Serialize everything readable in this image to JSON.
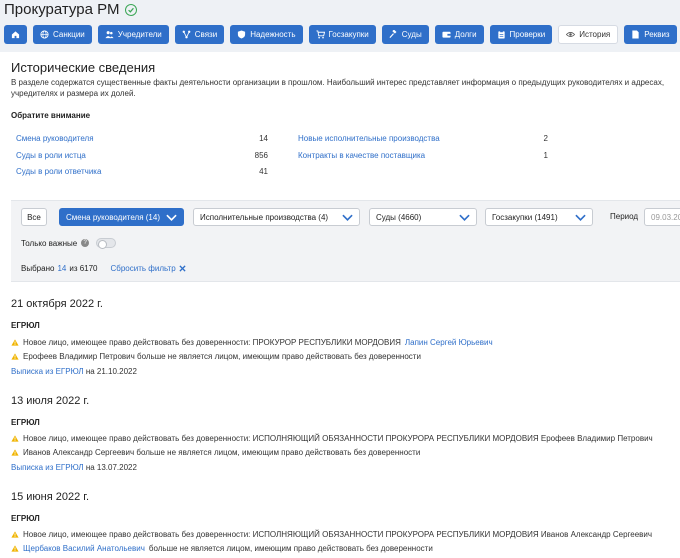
{
  "header": {
    "title": "Прокуратура РМ",
    "tabs": [
      {
        "label": "",
        "icon": "home-icon"
      },
      {
        "label": "Санкции",
        "icon": "globe-icon"
      },
      {
        "label": "Учредители",
        "icon": "users-icon"
      },
      {
        "label": "Связи",
        "icon": "network-icon"
      },
      {
        "label": "Надежность",
        "icon": "shield-icon"
      },
      {
        "label": "Госзакупки",
        "icon": "cart-icon"
      },
      {
        "label": "Суды",
        "icon": "gavel-icon"
      },
      {
        "label": "Долги",
        "icon": "wallet-icon"
      },
      {
        "label": "Проверки",
        "icon": "clipboard-icon"
      },
      {
        "label": "История",
        "icon": "eye-icon",
        "active": true
      },
      {
        "label": "Реквиз",
        "icon": "document-icon"
      }
    ]
  },
  "history": {
    "title": "Исторические сведения",
    "intro": "В разделе содержатся существенные факты деятельности организации в прошлом. Наибольший интерес представляет информация о предыдущих руководителях и адресах, учредителях и размера их долей.",
    "notice": "Обратите внимание",
    "stats_left": [
      {
        "label": "Смена руководителя",
        "value": "14"
      },
      {
        "label": "Суды в роли истца",
        "value": "856"
      },
      {
        "label": "Суды в роли ответчика",
        "value": "41"
      }
    ],
    "stats_right": [
      {
        "label": "Новые исполнительные производства",
        "value": "2"
      },
      {
        "label": "Контракты в качестве поставщика",
        "value": "1"
      }
    ]
  },
  "filters": {
    "all": "Все",
    "dropdowns": [
      {
        "label": "Смена руководителя (14)",
        "active": true
      },
      {
        "label": "Исполнительные производства (4)",
        "active": false
      },
      {
        "label": "Суды (4660)",
        "active": false
      },
      {
        "label": "Госзакупки (1491)",
        "active": false
      }
    ],
    "period_label": "Период",
    "period_value": "09.03.20",
    "important_label": "Только важные",
    "selected_prefix": "Выбрано",
    "selected_count": "14",
    "selected_of": "из 6170",
    "reset": "Сбросить фильтр"
  },
  "events": [
    {
      "date": "21 октября 2022 г.",
      "source": "ЕГРЮЛ",
      "items": [
        {
          "text": "Новое лицо, имеющее право действовать без доверенности: ПРОКУРОР РЕСПУБЛИКИ МОРДОВИЯ",
          "person": "Лапин Сергей Юрьевич",
          "person_first": false
        },
        {
          "text": "Ерофеев Владимир Петрович больше не является лицом, имеющим право действовать без доверенности",
          "person": "",
          "person_first": false
        }
      ],
      "extract_link": "Выписка из ЕГРЮЛ",
      "extract_date": "на 21.10.2022"
    },
    {
      "date": "13 июля 2022 г.",
      "source": "ЕГРЮЛ",
      "items": [
        {
          "text": "Новое лицо, имеющее право действовать без доверенности: ИСПОЛНЯЮЩИЙ ОБЯЗАННОСТИ ПРОКУРОРА РЕСПУБЛИКИ МОРДОВИЯ Ерофеев Владимир Петрович",
          "person": "",
          "person_first": false
        },
        {
          "text": "Иванов Александр Сергеевич больше не является лицом, имеющим право действовать без доверенности",
          "person": "",
          "person_first": false
        }
      ],
      "extract_link": "Выписка из ЕГРЮЛ",
      "extract_date": "на 13.07.2022"
    },
    {
      "date": "15 июня 2022 г.",
      "source": "ЕГРЮЛ",
      "items": [
        {
          "text": "Новое лицо, имеющее право действовать без доверенности: ИСПОЛНЯЮЩИЙ ОБЯЗАННОСТИ ПРОКУРОРА РЕСПУБЛИКИ МОРДОВИЯ Иванов Александр Сергеевич",
          "person": "",
          "person_first": false
        },
        {
          "text": "больше не является лицом, имеющим право действовать без доверенности",
          "person": "Щербаков Василий Анатольевич",
          "person_first": true
        }
      ],
      "extract_link": "",
      "extract_date": ""
    }
  ],
  "colors": {
    "accent": "#2f6fc9",
    "warning": "#f0b400",
    "success": "#3aa655"
  }
}
